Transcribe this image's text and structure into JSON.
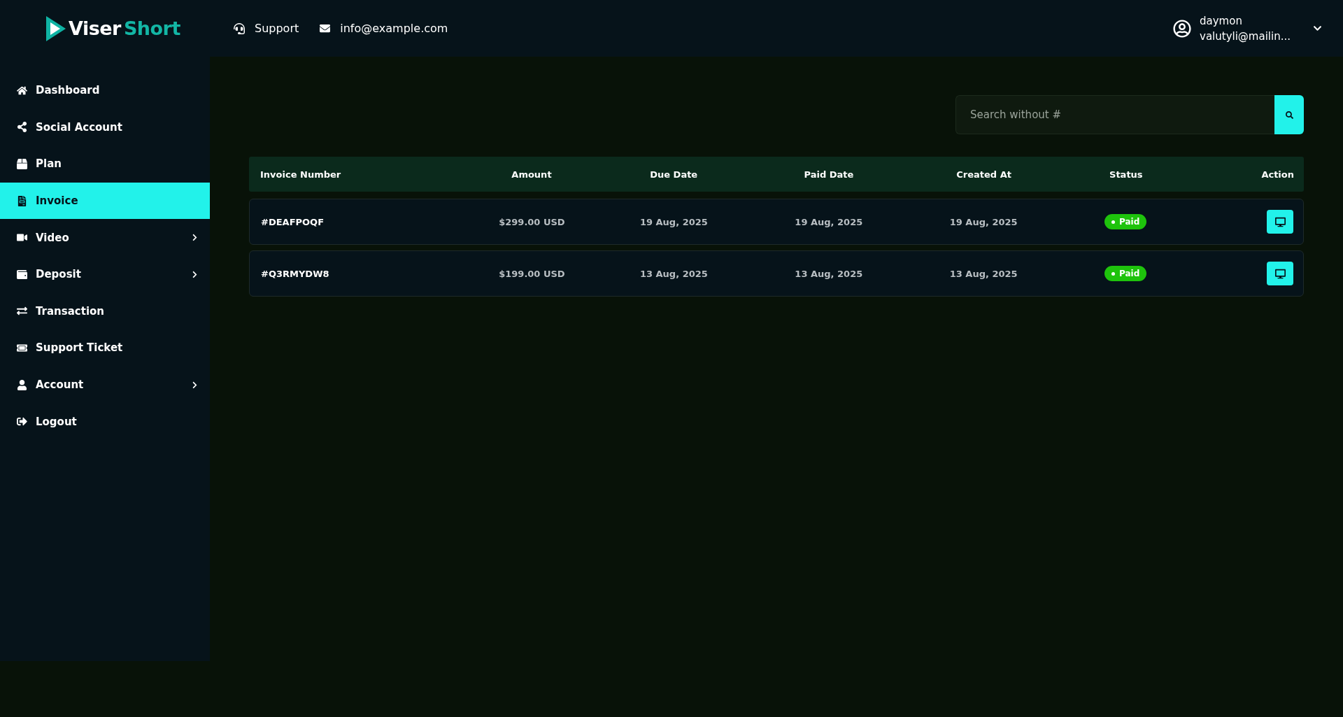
{
  "logo": {
    "first": "Viser",
    "second": "Short"
  },
  "header": {
    "support": "Support",
    "email": "info@example.com",
    "user": {
      "name": "daymon",
      "email": "valutyli@mailin..."
    }
  },
  "sidebar": {
    "items": [
      {
        "label": "Dashboard",
        "selected": false,
        "has_submenu": false
      },
      {
        "label": "Social Account",
        "selected": false,
        "has_submenu": false
      },
      {
        "label": "Plan",
        "selected": false,
        "has_submenu": false
      },
      {
        "label": "Invoice",
        "selected": true,
        "has_submenu": false
      },
      {
        "label": "Video",
        "selected": false,
        "has_submenu": true
      },
      {
        "label": "Deposit",
        "selected": false,
        "has_submenu": true
      },
      {
        "label": "Transaction",
        "selected": false,
        "has_submenu": false
      },
      {
        "label": "Support Ticket",
        "selected": false,
        "has_submenu": false
      },
      {
        "label": "Account",
        "selected": false,
        "has_submenu": true
      },
      {
        "label": "Logout",
        "selected": false,
        "has_submenu": false
      }
    ]
  },
  "search": {
    "placeholder": "Search without #"
  },
  "table": {
    "columns": [
      "Invoice Number",
      "Amount",
      "Due Date",
      "Paid Date",
      "Created At",
      "Status",
      "Action"
    ],
    "rows": [
      {
        "invoice": "#DEAFPOQF",
        "amount": "$299.00 USD",
        "due": "19 Aug, 2025",
        "paid": "19 Aug, 2025",
        "created": "19 Aug, 2025",
        "status": {
          "text": "Paid",
          "kind": "paid"
        }
      },
      {
        "invoice": "#Q3RMYDW8",
        "amount": "$199.00 USD",
        "due": "13 Aug, 2025",
        "paid": "13 Aug, 2025",
        "created": "13 Aug, 2025",
        "status": {
          "text": "Paid",
          "kind": "paid"
        }
      }
    ]
  }
}
